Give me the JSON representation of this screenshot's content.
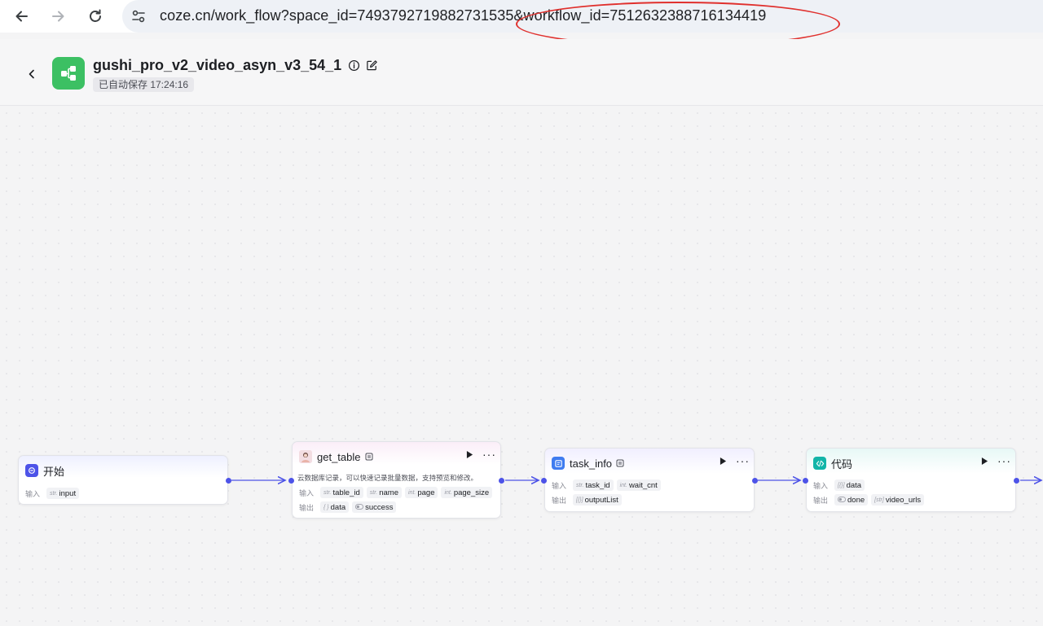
{
  "browser": {
    "url": "coze.cn/work_flow?space_id=7493792719882731535&workflow_id=7512632388716134419"
  },
  "header": {
    "title": "gushi_pro_v2_video_asyn_v3_54_1",
    "autosave": "已自动保存 17:24:16"
  },
  "labels": {
    "input": "输入",
    "output": "输出"
  },
  "nodes": {
    "start": {
      "title": "开始",
      "inputs": [
        {
          "type": "str.",
          "name": "input"
        }
      ]
    },
    "get_table": {
      "title": "get_table",
      "desc": "云数据库记录，可以快速记录批量数据，支持预览和修改。",
      "inputs": [
        {
          "type": "str.",
          "name": "table_id"
        },
        {
          "type": "str.",
          "name": "name"
        },
        {
          "type": "int.",
          "name": "page"
        },
        {
          "type": "int.",
          "name": "page_size"
        }
      ],
      "outputs": [
        {
          "type": "{ }",
          "name": "data"
        },
        {
          "type": "",
          "name": "success"
        }
      ]
    },
    "task_info": {
      "title": "task_info",
      "inputs": [
        {
          "type": "str.",
          "name": "task_id"
        },
        {
          "type": "int.",
          "name": "wait_cnt"
        }
      ],
      "outputs": [
        {
          "type": "[{}]",
          "name": "outputList"
        }
      ]
    },
    "code": {
      "title": "代码",
      "inputs": [
        {
          "type": "[{}]",
          "name": "data"
        }
      ],
      "outputs": [
        {
          "type": "",
          "name": "done"
        },
        {
          "type": "[str]",
          "name": "video_urls"
        }
      ]
    }
  },
  "colors": {
    "accent": "#4d53e8",
    "highlight": "#e0302d",
    "logo": "#3cc063",
    "code_icon": "#12b5a8"
  }
}
